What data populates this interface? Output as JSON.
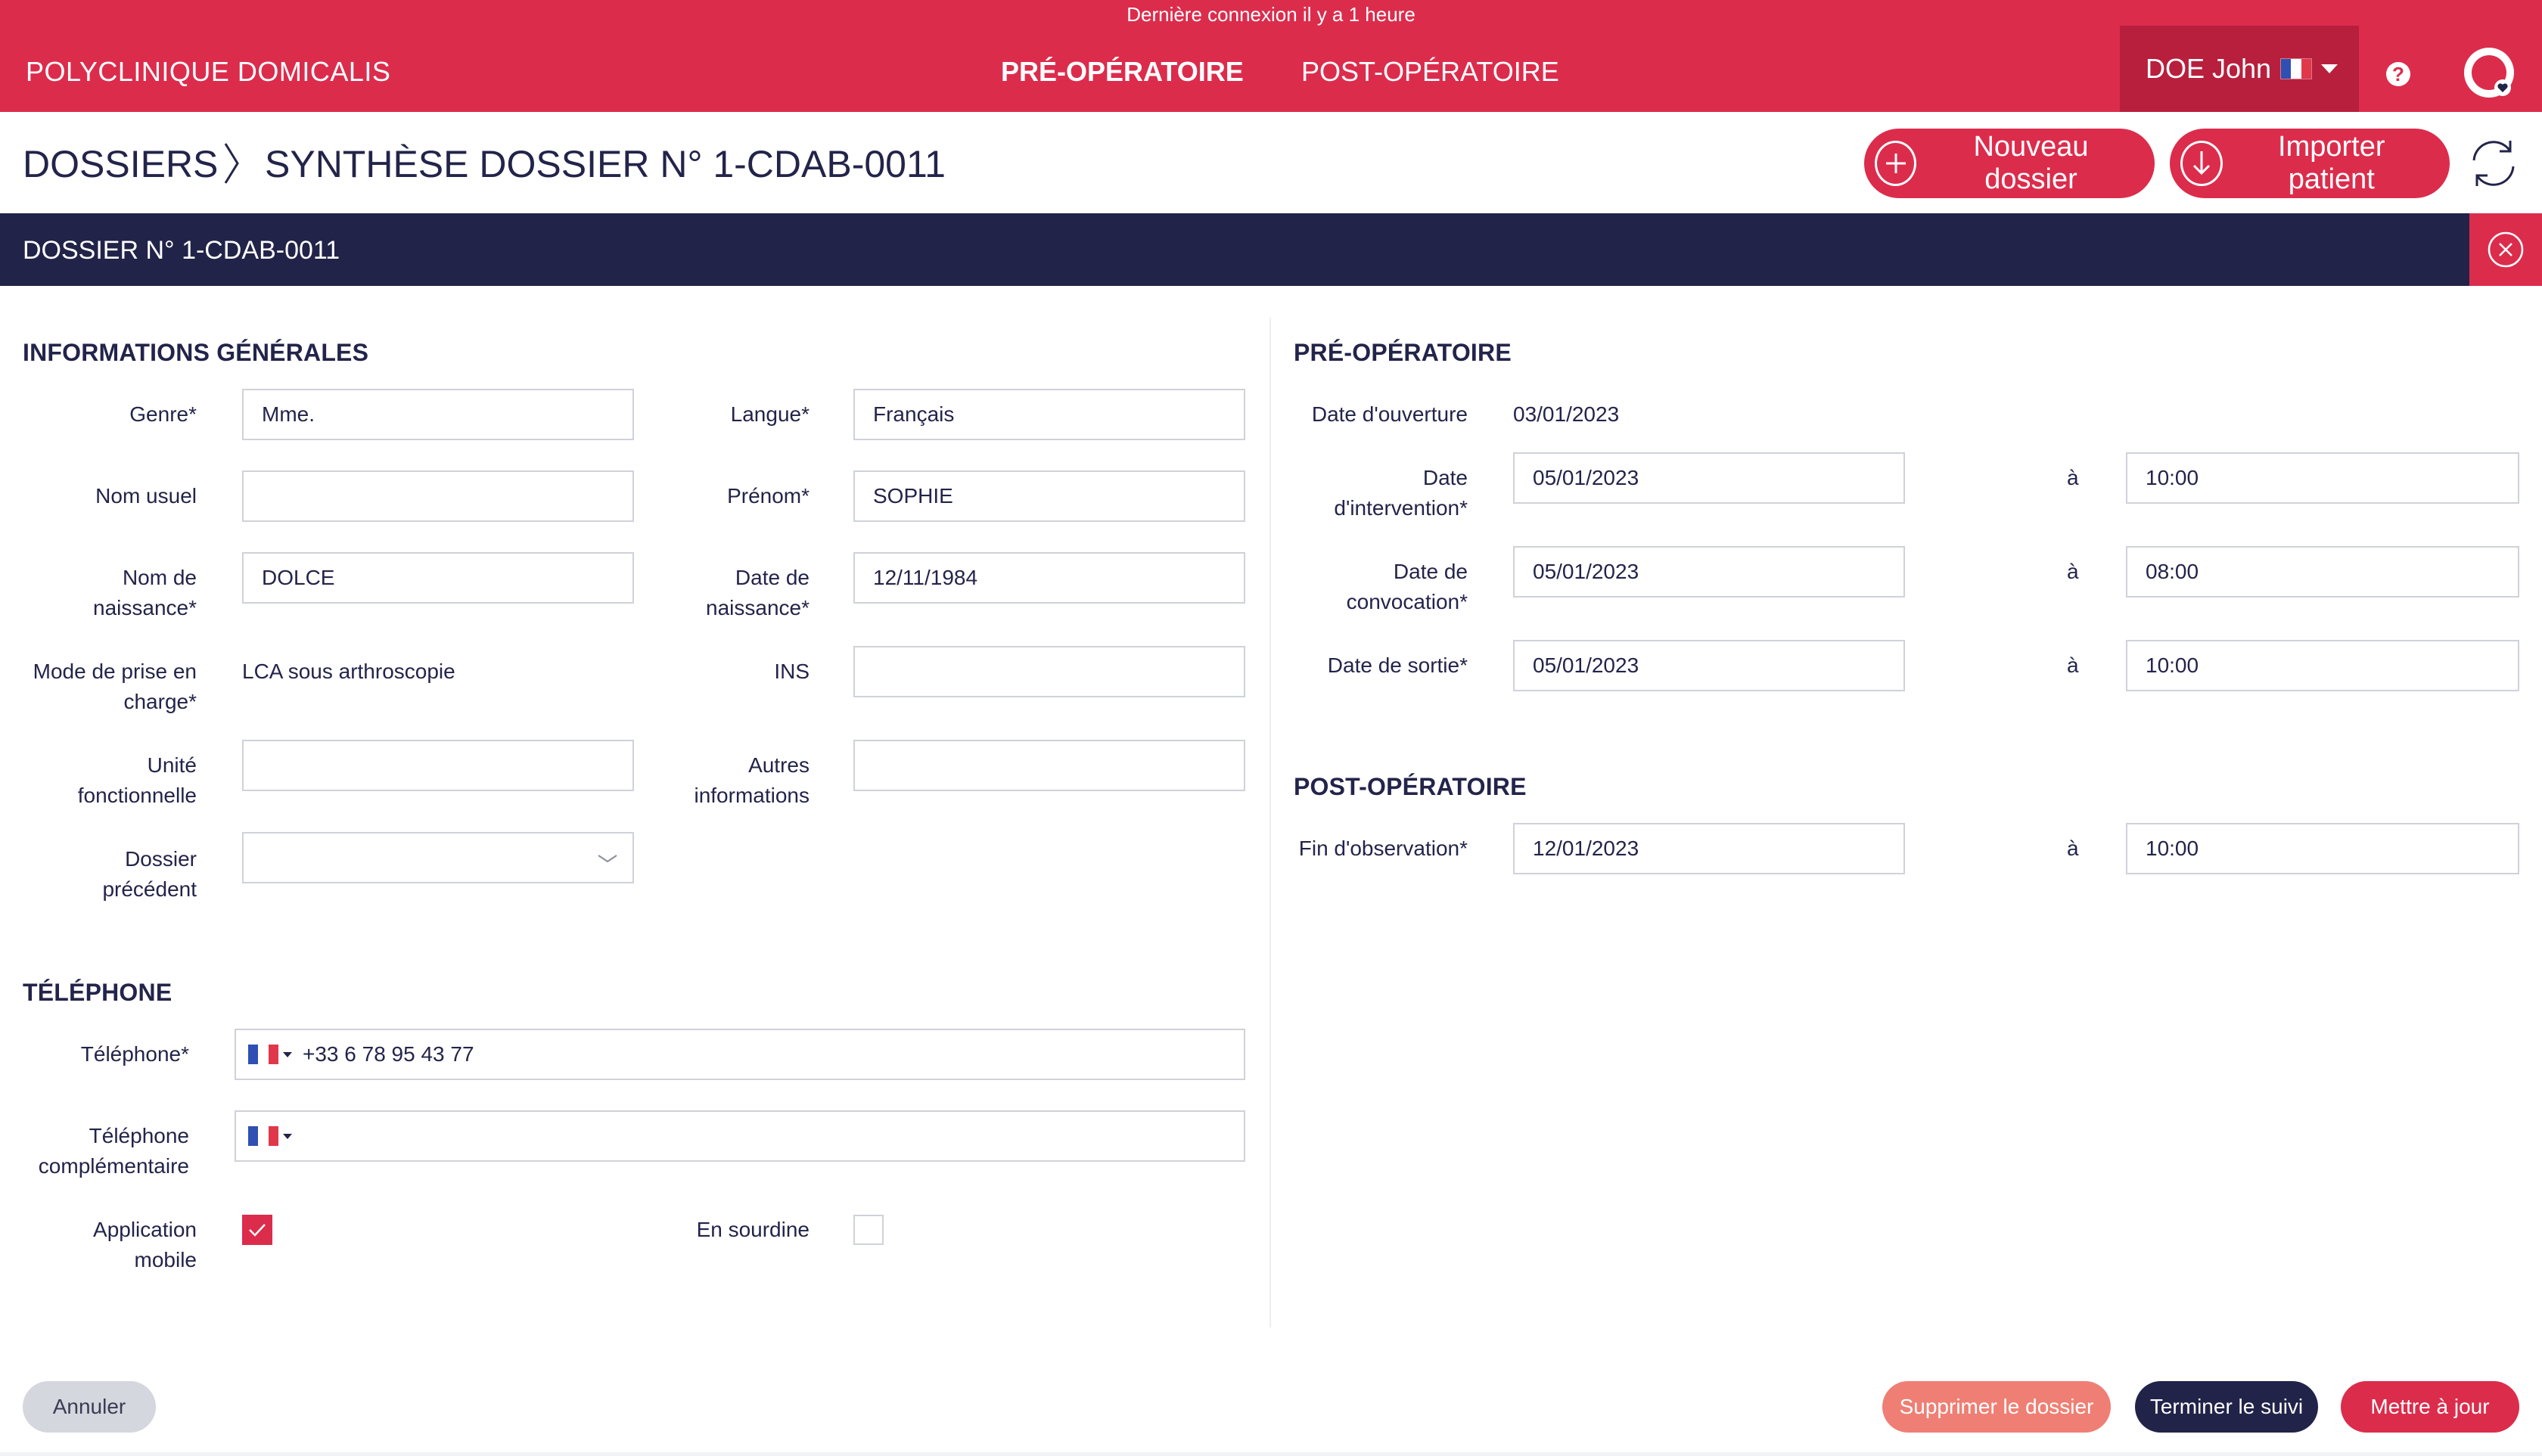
{
  "header": {
    "last_login": "Dernière connexion il y a 1 heure",
    "clinic_name": "POLYCLINIQUE DOMICALIS",
    "nav_pre": "PRÉ-OPÉRATOIRE",
    "nav_post": "POST-OPÉRATOIRE",
    "user_name": "DOE John",
    "help_glyph": "?",
    "accent_color": "#dc2c4c"
  },
  "breadcrumb": {
    "root": "DOSSIERS",
    "current": "SYNTHÈSE DOSSIER N° 1-CDAB-0011"
  },
  "actions": {
    "new_file": "Nouveau dossier",
    "import_patient": "Importer patient"
  },
  "dossier": {
    "title": "DOSSIER N° 1-CDAB-0011"
  },
  "general_info": {
    "title": "INFORMATIONS GÉNÉRALES",
    "genre_label": "Genre*",
    "genre_value": "Mme.",
    "langue_label": "Langue*",
    "langue_value": "Français",
    "nom_usuel_label": "Nom usuel",
    "nom_usuel_value": "",
    "prenom_label": "Prénom*",
    "prenom_value": "SOPHIE",
    "nom_naissance_label_1": "Nom de",
    "nom_naissance_label_2": "naissance*",
    "nom_naissance_value": "DOLCE",
    "date_naissance_label_1": "Date de",
    "date_naissance_label_2": "naissance*",
    "date_naissance_value": "12/11/1984",
    "mode_label_1": "Mode de prise en",
    "mode_label_2": "charge*",
    "mode_value": "LCA sous arthroscopie",
    "ins_label": "INS",
    "ins_value": "",
    "unite_label_1": "Unité",
    "unite_label_2": "fonctionnelle",
    "unite_value": "",
    "autres_label_1": "Autres",
    "autres_label_2": "informations",
    "autres_value": "",
    "dossier_prec_label_1": "Dossier",
    "dossier_prec_label_2": "précédent",
    "dossier_prec_value": ""
  },
  "telephone": {
    "title": "TÉLÉPHONE",
    "phone_label": "Téléphone*",
    "phone_value": "+33 6 78 95 43 77",
    "phone2_label_1": "Téléphone",
    "phone2_label_2": "complémentaire",
    "phone2_value": "",
    "app_label_1": "Application",
    "app_label_2": "mobile",
    "app_checked": true,
    "mute_label": "En sourdine",
    "mute_checked": false
  },
  "pre_op": {
    "title": "PRÉ-OPÉRATOIRE",
    "ouverture_label": "Date d'ouverture",
    "ouverture_value": "03/01/2023",
    "intervention_label_1": "Date",
    "intervention_label_2": "d'intervention*",
    "intervention_date": "05/01/2023",
    "intervention_time": "10:00",
    "convocation_label_1": "Date de",
    "convocation_label_2": "convocation*",
    "convocation_date": "05/01/2023",
    "convocation_time": "08:00",
    "sortie_label": "Date de sortie*",
    "sortie_date": "05/01/2023",
    "sortie_time": "10:00",
    "a_label": "à"
  },
  "post_op": {
    "title": "POST-OPÉRATOIRE",
    "fin_label": "Fin d'observation*",
    "fin_date": "12/01/2023",
    "fin_time": "10:00"
  },
  "footer": {
    "cancel": "Annuler",
    "delete": "Supprimer le dossier",
    "end": "Terminer le suivi",
    "update": "Mettre à jour"
  }
}
